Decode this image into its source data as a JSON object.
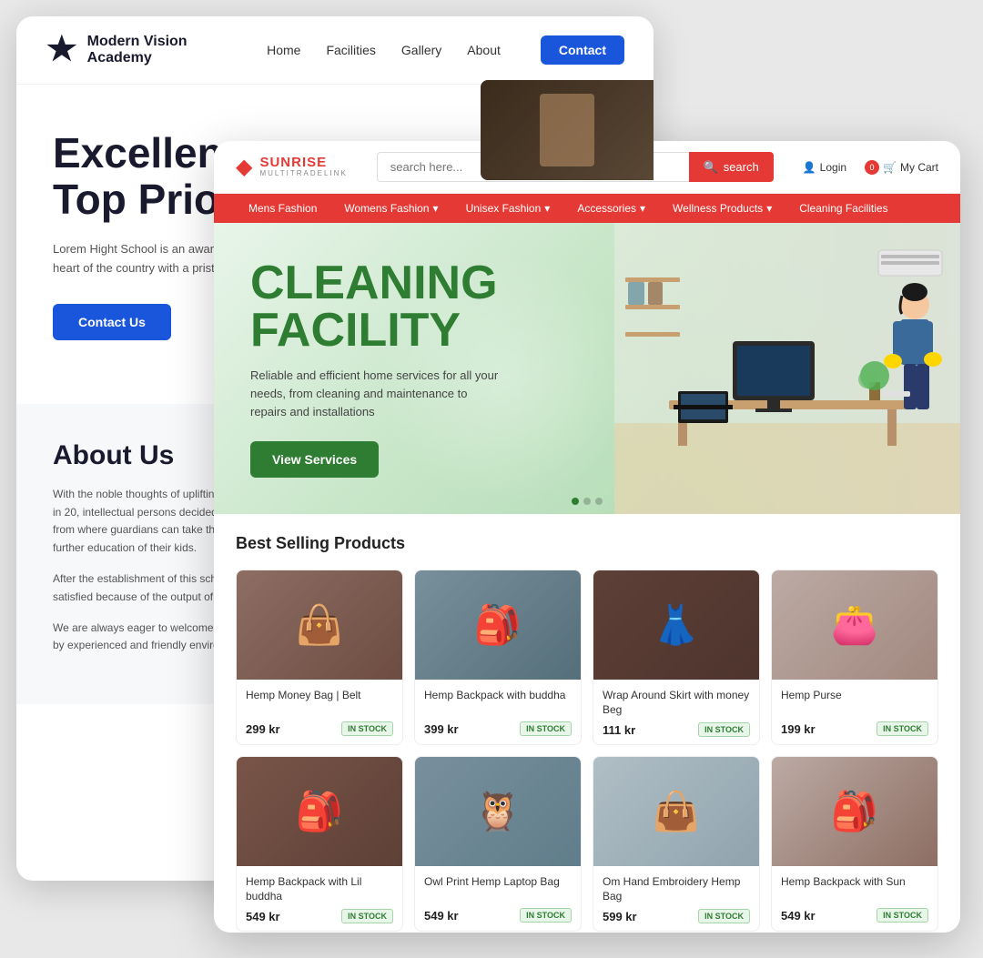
{
  "back_card": {
    "logo_text": "Modern Vision Academy",
    "nav_links": [
      "Home",
      "Facilities",
      "Gallery",
      "About"
    ],
    "contact_btn": "Contact",
    "hero_title_line1": "Excellen",
    "hero_title_line2": "Top Prior",
    "hero_desc": "Lorem Hight School is an award-winning school at the heart of the country with a pristine environment.",
    "hero_btn": "Contact Us",
    "about_title": "About Us",
    "about_para1": "With the noble thoughts of uplifting the kids of this remote area in 20, intellectual persons decided to establish a medium school from where guardians can take their children to city areas to further education of their kids.",
    "about_para2": "After the establishment of this school, they are very happy and satisfied because of the output of the institute.",
    "about_para3": "We are always eager to welcome those willing to get educated by experienced and friendly environment in a peaceful a..."
  },
  "front_card": {
    "logo_main": "SUNRISE",
    "logo_sub": "MULTITRADELINK",
    "search_placeholder": "search here...",
    "search_btn": "search",
    "login_label": "Login",
    "cart_label": "My Cart",
    "cart_count": "0",
    "nav_items": [
      "Mens Fashion",
      "Womens Fashion",
      "Unisex Fashion",
      "Accessories",
      "Wellness Products",
      "Cleaning Facilities"
    ],
    "hero_title_line1": "CLEANING",
    "hero_title_line2": "FACILITY",
    "hero_desc": "Reliable and efficient home services for all your needs, from cleaning and maintenance to repairs and installations",
    "hero_btn": "View Services",
    "products_title": "Best Selling Products",
    "products": [
      {
        "name": "Hemp Money Bag | Belt",
        "price": "299 kr",
        "stock": "IN STOCK",
        "img": "img-hemp-belt"
      },
      {
        "name": "Hemp Backpack with buddha",
        "price": "399 kr",
        "stock": "IN STOCK",
        "img": "img-buddha-back"
      },
      {
        "name": "Wrap Around Skirt with money Beg",
        "price": "111 kr",
        "stock": "IN STOCK",
        "img": "img-skirt"
      },
      {
        "name": "Hemp Purse",
        "price": "199 kr",
        "stock": "IN STOCK",
        "img": "img-purse"
      },
      {
        "name": "Hemp Backpack with Lil buddha",
        "price": "549 kr",
        "stock": "IN STOCK",
        "img": "img-lil-buddha"
      },
      {
        "name": "Owl Print Hemp Laptop Bag",
        "price": "549 kr",
        "stock": "IN STOCK",
        "img": "img-owl"
      },
      {
        "name": "Om Hand Embroidery Hemp Bag",
        "price": "599 kr",
        "stock": "IN STOCK",
        "img": "img-om-hand"
      },
      {
        "name": "Hemp Backpack with Sun",
        "price": "549 kr",
        "stock": "IN STOCK",
        "img": "img-sun-back"
      }
    ]
  }
}
